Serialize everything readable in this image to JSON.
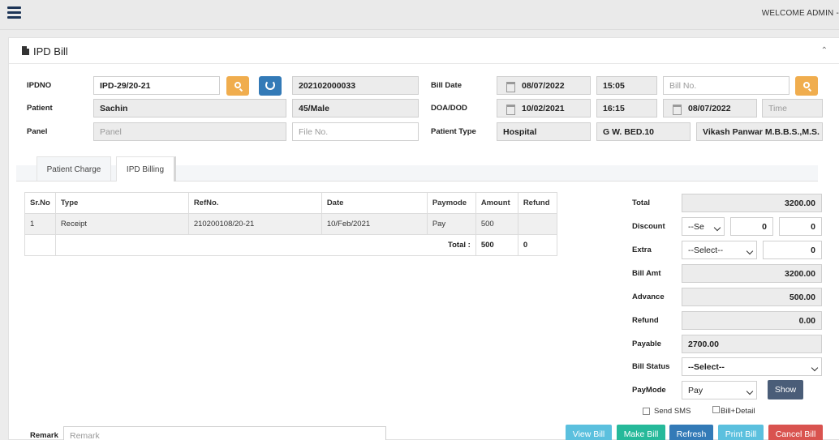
{
  "topbar": {
    "welcome": "WELCOME ADMIN -"
  },
  "panel": {
    "title": "IPD Bill"
  },
  "form": {
    "ipdno_label": "IPDNO",
    "ipdno_value": "IPD-29/20-21",
    "ipd_code": "202102000033",
    "patient_label": "Patient",
    "patient_name": "Sachin",
    "patient_agesex": "45/Male",
    "panel_label": "Panel",
    "panel_placeholder": "Panel",
    "fileno_placeholder": "File No.",
    "billdate_label": "Bill Date",
    "bill_date": "08/07/2022",
    "bill_time": "15:05",
    "billno_placeholder": "Bill No.",
    "doadod_label": "DOA/DOD",
    "doa_date": "10/02/2021",
    "doa_time": "16:15",
    "dod_date": "08/07/2022",
    "time_placeholder": "Time",
    "patienttype_label": "Patient Type",
    "patient_type": "Hospital",
    "bed": "G W. BED.10",
    "doctor": "Vikash Panwar M.B.B.S.,M.S."
  },
  "tabs": [
    {
      "label": "Patient Charge"
    },
    {
      "label": "IPD Billing"
    }
  ],
  "table": {
    "headers": [
      "Sr.No",
      "Type",
      "RefNo.",
      "Date",
      "Paymode",
      "Amount",
      "Refund"
    ],
    "rows": [
      {
        "srno": "1",
        "type": "Receipt",
        "refno": "210200108/20-21",
        "date": "10/Feb/2021",
        "paymode": "Pay",
        "amount": "500",
        "refund": ""
      }
    ],
    "total_label": "Total :",
    "total_amount": "500",
    "total_refund": "0"
  },
  "summary": {
    "total_label": "Total",
    "total": "3200.00",
    "discount_label": "Discount",
    "discount_select": "--Se",
    "discount_value1": "0",
    "discount_value2": "0",
    "extra_label": "Extra",
    "extra_select": "--Select--",
    "extra_value": "0",
    "billamt_label": "Bill Amt",
    "billamt": "3200.00",
    "advance_label": "Advance",
    "advance": "500.00",
    "refund_label": "Refund",
    "refund": "0.00",
    "payable_label": "Payable",
    "payable": "2700.00",
    "billstatus_label": "Bill Status",
    "billstatus_select": "--Select--",
    "paymode_label": "PayMode",
    "paymode_select": "Pay",
    "show_button": "Show",
    "sendsms_label": "Send SMS",
    "billdetail_label": "Bill+Detail"
  },
  "remark": {
    "label": "Remark",
    "placeholder": "Remark"
  },
  "actions": {
    "view": "View Bill",
    "make": "Make Bill",
    "refresh": "Refresh",
    "print": "Print Bill",
    "cancel": "Cancel Bill"
  },
  "colors": {
    "view": "#5bc0de",
    "make": "#26b99a",
    "refresh": "#337ab7",
    "print": "#5bc0de",
    "cancel": "#d9534f",
    "show": "#4a5d78"
  }
}
